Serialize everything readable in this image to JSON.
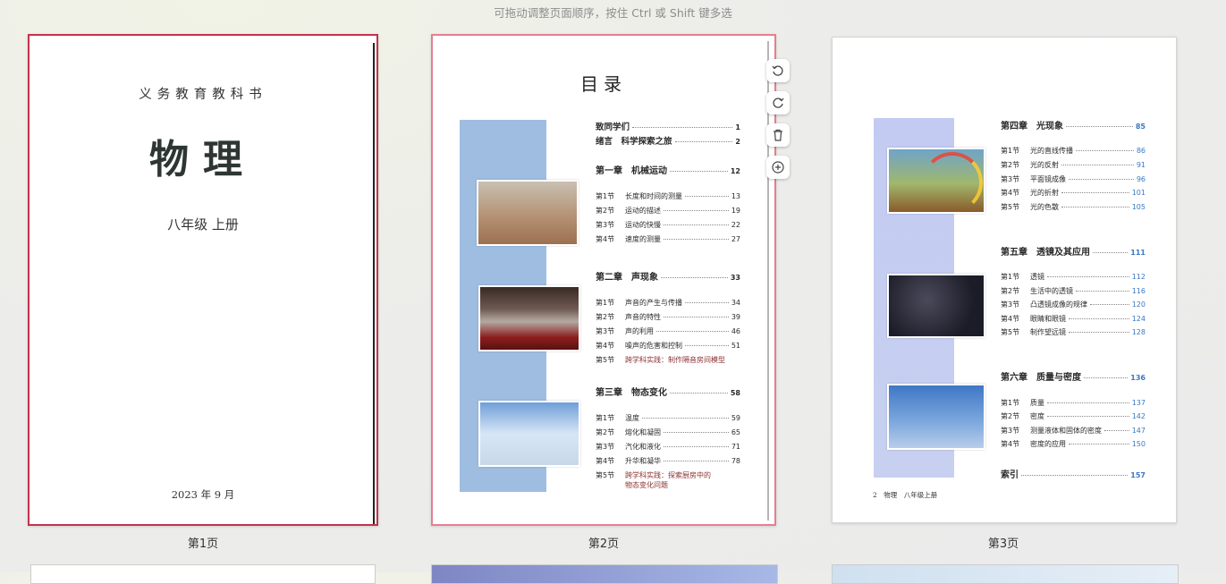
{
  "hint": "可拖动调整页面顺序，按住 Ctrl 或 Shift 键多选",
  "pages": [
    {
      "label": "第1页"
    },
    {
      "label": "第2页"
    },
    {
      "label": "第3页"
    }
  ],
  "page1": {
    "series": "义务教育教科书",
    "subject": "物理",
    "grade": "八年级 上册",
    "date": "2023 年 9 月"
  },
  "page2": {
    "heading": "目录",
    "entries": [
      {
        "sec": "",
        "name": "致同学们",
        "num": "1",
        "type": "chap-small"
      },
      {
        "sec": "",
        "name": "绪言　科学探索之旅",
        "num": "2",
        "type": "chap-small"
      },
      {
        "sec": "",
        "name": "第一章　机械运动",
        "num": "12",
        "type": "chap"
      },
      {
        "sec": "第1节",
        "name": "长度和时间的测量",
        "num": "13",
        "type": "sec"
      },
      {
        "sec": "第2节",
        "name": "运动的描述",
        "num": "19",
        "type": "sec"
      },
      {
        "sec": "第3节",
        "name": "运动的快慢",
        "num": "22",
        "type": "sec"
      },
      {
        "sec": "第4节",
        "name": "速度的测量",
        "num": "27",
        "type": "sec"
      },
      {
        "sec": "",
        "name": "第二章　声现象",
        "num": "33",
        "type": "chap"
      },
      {
        "sec": "第1节",
        "name": "声音的产生与传播",
        "num": "34",
        "type": "sec"
      },
      {
        "sec": "第2节",
        "name": "声音的特性",
        "num": "39",
        "type": "sec"
      },
      {
        "sec": "第3节",
        "name": "声的利用",
        "num": "46",
        "type": "sec"
      },
      {
        "sec": "第4节",
        "name": "噪声的危害和控制",
        "num": "51",
        "type": "sec"
      },
      {
        "sec": "第5节",
        "name": "跨学科实践：制作隔音房间模型",
        "num": "",
        "type": "red"
      },
      {
        "sec": "",
        "name": "第三章　物态变化",
        "num": "58",
        "type": "chap"
      },
      {
        "sec": "第1节",
        "name": "温度",
        "num": "59",
        "type": "sec"
      },
      {
        "sec": "第2节",
        "name": "熔化和凝固",
        "num": "65",
        "type": "sec"
      },
      {
        "sec": "第3节",
        "name": "汽化和液化",
        "num": "71",
        "type": "sec"
      },
      {
        "sec": "第4节",
        "name": "升华和凝华",
        "num": "78",
        "type": "sec"
      },
      {
        "sec": "第5节",
        "name": "跨学科实践：探索厨房中的",
        "num": "",
        "type": "red"
      },
      {
        "sec": "",
        "name": "物态变化问题",
        "num": "",
        "type": "red"
      }
    ]
  },
  "page3": {
    "footer": "2　物理　八年级上册",
    "entries": [
      {
        "sec": "",
        "name": "第四章　光现象",
        "num": "85",
        "type": "chap"
      },
      {
        "sec": "第1节",
        "name": "光的直线传播",
        "num": "86",
        "type": "sec"
      },
      {
        "sec": "第2节",
        "name": "光的反射",
        "num": "91",
        "type": "sec"
      },
      {
        "sec": "第3节",
        "name": "平面镜成像",
        "num": "96",
        "type": "sec"
      },
      {
        "sec": "第4节",
        "name": "光的折射",
        "num": "101",
        "type": "sec"
      },
      {
        "sec": "第5节",
        "name": "光的色散",
        "num": "105",
        "type": "sec"
      },
      {
        "sec": "",
        "name": "第五章　透镜及其应用",
        "num": "111",
        "type": "chap"
      },
      {
        "sec": "第1节",
        "name": "透镜",
        "num": "112",
        "type": "sec"
      },
      {
        "sec": "第2节",
        "name": "生活中的透镜",
        "num": "116",
        "type": "sec"
      },
      {
        "sec": "第3节",
        "name": "凸透镜成像的规律",
        "num": "120",
        "type": "sec"
      },
      {
        "sec": "第4节",
        "name": "眼睛和眼镜",
        "num": "124",
        "type": "sec"
      },
      {
        "sec": "第5节",
        "name": "制作望远镜",
        "num": "128",
        "type": "sec"
      },
      {
        "sec": "",
        "name": "第六章　质量与密度",
        "num": "136",
        "type": "chap"
      },
      {
        "sec": "第1节",
        "name": "质量",
        "num": "137",
        "type": "sec"
      },
      {
        "sec": "第2节",
        "name": "密度",
        "num": "142",
        "type": "sec"
      },
      {
        "sec": "第3节",
        "name": "测量液体和固体的密度",
        "num": "147",
        "type": "sec"
      },
      {
        "sec": "第4节",
        "name": "密度的应用",
        "num": "150",
        "type": "sec"
      },
      {
        "sec": "",
        "name": "索引",
        "num": "157",
        "type": "chap"
      }
    ]
  },
  "toolbar": {
    "rotate_left_icon": "rotate-left-icon",
    "rotate_right_icon": "rotate-right-icon",
    "delete_icon": "trash-icon",
    "insert_icon": "plus-circle-icon"
  },
  "colors": {
    "selected_border": "#c4314b",
    "hover_border": "#e37f90",
    "toc_band": "#9ebde0",
    "page3_numbers": "#3a78c4"
  }
}
